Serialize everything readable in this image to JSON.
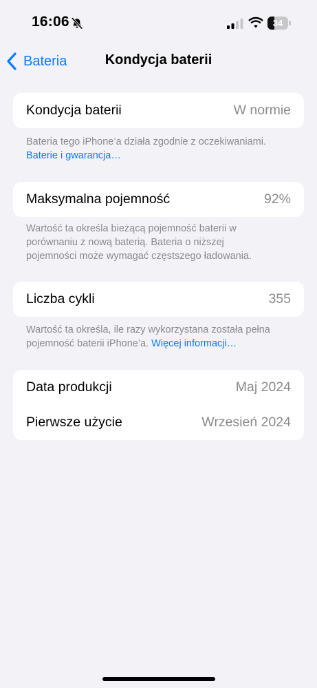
{
  "status_bar": {
    "time": "16:06",
    "battery_level": "34",
    "battery_fraction": 0.34,
    "icons": [
      "bell-slash-icon",
      "cellular-signal-icon",
      "wifi-icon",
      "battery-icon"
    ]
  },
  "nav": {
    "back_label": "Bateria",
    "title": "Kondycja baterii"
  },
  "sections": {
    "health": {
      "label": "Kondycja baterii",
      "value": "W normie",
      "footer_text": "Bateria tego iPhone’a działa zgodnie z oczekiwaniami.",
      "footer_link": "Baterie i gwarancja…"
    },
    "capacity": {
      "label": "Maksymalna pojemność",
      "value": "92%",
      "footer_text": "Wartość ta określa bieżącą pojemność baterii w porównaniu z nową baterią. Bateria o niższej pojemności może wymagać częstszego ładowania."
    },
    "cycles": {
      "label": "Liczba cykli",
      "value": "355",
      "footer_text": "Wartość ta określa, ile razy wykorzystana została pełna pojemność baterii iPhone’a. ",
      "footer_link": "Więcej informacji…"
    },
    "dates": {
      "manufacture_label": "Data produkcji",
      "manufacture_value": "Maj 2024",
      "first_use_label": "Pierwsze użycie",
      "first_use_value": "Wrzesień 2024"
    }
  },
  "colors": {
    "background": "#f2f2f7",
    "accent": "#0a7aff",
    "secondary_text": "#8a8a8e"
  }
}
